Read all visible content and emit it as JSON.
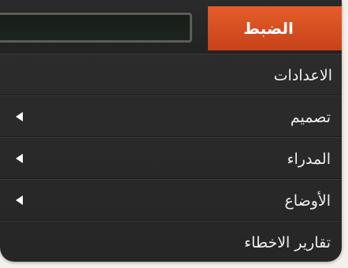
{
  "header": {
    "active_tab": "الضبط",
    "search_value": ""
  },
  "menu": {
    "items": [
      {
        "label": "الاعدادات",
        "has_submenu": false
      },
      {
        "label": "تصميم",
        "has_submenu": true
      },
      {
        "label": "المدراء",
        "has_submenu": true
      },
      {
        "label": "الأوضاع",
        "has_submenu": true
      },
      {
        "label": "تقارير الاخطاء",
        "has_submenu": false
      }
    ]
  },
  "colors": {
    "accent": "#d9501f",
    "background": "#2a2a2a",
    "text": "#f0f0f0"
  }
}
